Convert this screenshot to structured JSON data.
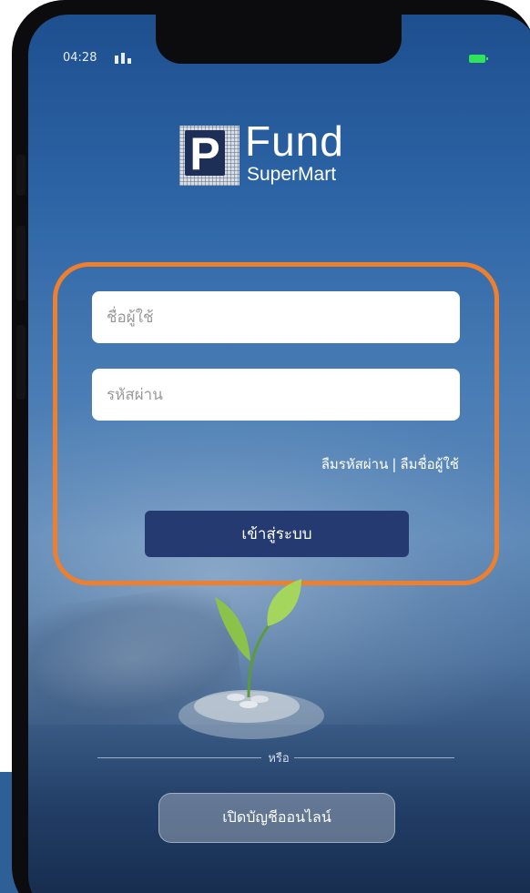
{
  "status_bar": {
    "time": "04:28"
  },
  "logo": {
    "mark_letter": "P",
    "line1": "Fund",
    "line2": "SuperMart"
  },
  "login": {
    "username_placeholder": "ชื่อผู้ใช้",
    "password_placeholder": "รหัสผ่าน",
    "forgot_password": "ลืมรหัสผ่าน",
    "separator": "|",
    "forgot_username": "ลืมชื่อผู้ใช้",
    "submit_label": "เข้าสู่ระบบ"
  },
  "alt": {
    "or_label": "หรือ",
    "open_account_label": "เปิดบัญชีออนไลน์"
  },
  "colors": {
    "highlight_border": "#ee7f2f",
    "login_button": "#243a70",
    "battery": "#2fe35a",
    "accent_block": "#2e5f97"
  },
  "icons": [
    "signal-icon",
    "battery-icon",
    "plant-coins-illustration"
  ]
}
